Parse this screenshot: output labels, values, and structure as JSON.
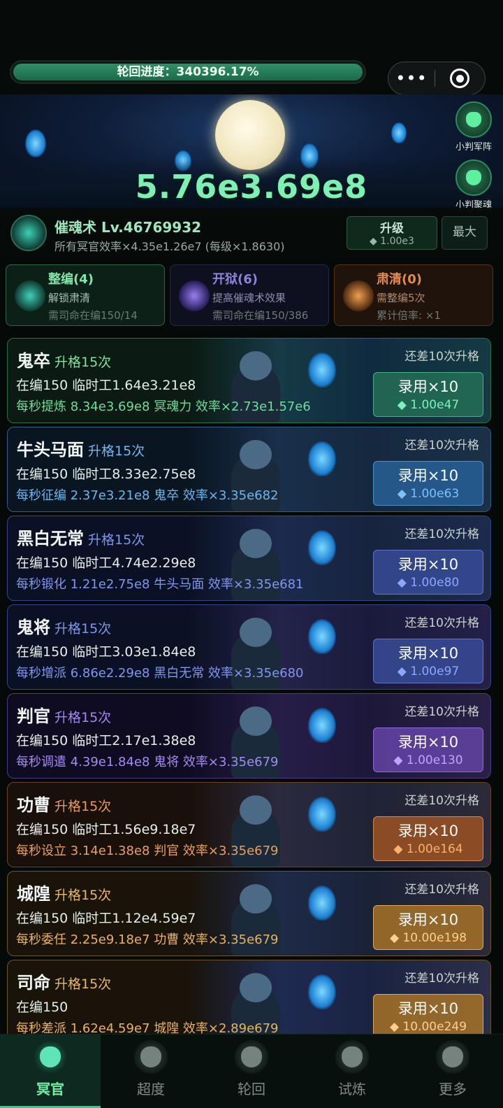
{
  "progress": {
    "label": "轮回进度：340396.17%",
    "fill_fraction": 1.0
  },
  "capsule": {
    "menu_glyph": "•••",
    "close_glyph": "◉"
  },
  "hero": {
    "big_number": "5.76e3.69e8"
  },
  "side_buttons": [
    {
      "label": "小判军阵",
      "icon": "formation-icon"
    },
    {
      "label": "小判聚魂",
      "icon": "soul-gather-icon"
    }
  ],
  "skill": {
    "name": "催魂术 Lv.46769932",
    "desc": "所有冥官效率×4.35e1.26e7 (每级×1.8630)",
    "upgrade_label": "升级",
    "upgrade_cost": "◆ 1.00e3",
    "max_label": "最大"
  },
  "cards": [
    {
      "title": "整编(4)",
      "line1": "解锁肃清",
      "line2": "需司命在编150/14"
    },
    {
      "title": "开狱(6)",
      "line1": "提高催魂术效果",
      "line2": "需司命在编150/386"
    },
    {
      "title": "肃清(0)",
      "line1": "需整编5次",
      "line2": "累计倍率: ×1"
    }
  ],
  "units": [
    {
      "name": "鬼卒",
      "rank": "升格15次",
      "staff": "在编150  临时工1.64e3.21e8",
      "rate": "每秒提炼 8.34e3.69e8 冥魂力  效率×2.73e1.57e6",
      "remain": "还差10次升格",
      "hire": "录用×10",
      "cost": "◆ 1.00e47"
    },
    {
      "name": "牛头马面",
      "rank": "升格15次",
      "staff": "在编150  临时工8.33e2.75e8",
      "rate": "每秒征编 2.37e3.21e8 鬼卒  效率×3.35e682",
      "remain": "还差10次升格",
      "hire": "录用×10",
      "cost": "◆ 1.00e63"
    },
    {
      "name": "黑白无常",
      "rank": "升格15次",
      "staff": "在编150  临时工4.74e2.29e8",
      "rate": "每秒锻化 1.21e2.75e8 牛头马面  效率×3.35e681",
      "remain": "还差10次升格",
      "hire": "录用×10",
      "cost": "◆ 1.00e80"
    },
    {
      "name": "鬼将",
      "rank": "升格15次",
      "staff": "在编150  临时工3.03e1.84e8",
      "rate": "每秒增派 6.86e2.29e8 黑白无常  效率×3.35e680",
      "remain": "还差10次升格",
      "hire": "录用×10",
      "cost": "◆ 1.00e97"
    },
    {
      "name": "判官",
      "rank": "升格15次",
      "staff": "在编150  临时工2.17e1.38e8",
      "rate": "每秒调遣 4.39e1.84e8 鬼将  效率×3.35e679",
      "remain": "还差10次升格",
      "hire": "录用×10",
      "cost": "◆ 1.00e130"
    },
    {
      "name": "功曹",
      "rank": "升格15次",
      "staff": "在编150  临时工1.56e9.18e7",
      "rate": "每秒设立 3.14e1.38e8 判官  效率×3.35e679",
      "remain": "还差10次升格",
      "hire": "录用×10",
      "cost": "◆ 1.00e164"
    },
    {
      "name": "城隍",
      "rank": "升格15次",
      "staff": "在编150  临时工1.12e4.59e7",
      "rate": "每秒委任 2.25e9.18e7 功曹  效率×3.35e679",
      "remain": "还差10次升格",
      "hire": "录用×10",
      "cost": "◆ 10.00e198"
    },
    {
      "name": "司命",
      "rank": "升格15次",
      "staff": "在编150",
      "rate": "每秒差派 1.62e4.59e7 城隍  效率×2.89e679",
      "remain": "还差10次升格",
      "hire": "录用×10",
      "cost": "◆ 10.00e249"
    }
  ],
  "nav": [
    {
      "label": "冥官",
      "icon": "ghost-officer-icon",
      "active": true
    },
    {
      "label": "超度",
      "icon": "salvation-icon",
      "active": false
    },
    {
      "label": "轮回",
      "icon": "reincarnation-icon",
      "active": false
    },
    {
      "label": "试炼",
      "icon": "trial-icon",
      "active": false
    },
    {
      "label": "更多",
      "icon": "more-icon",
      "active": false
    }
  ]
}
